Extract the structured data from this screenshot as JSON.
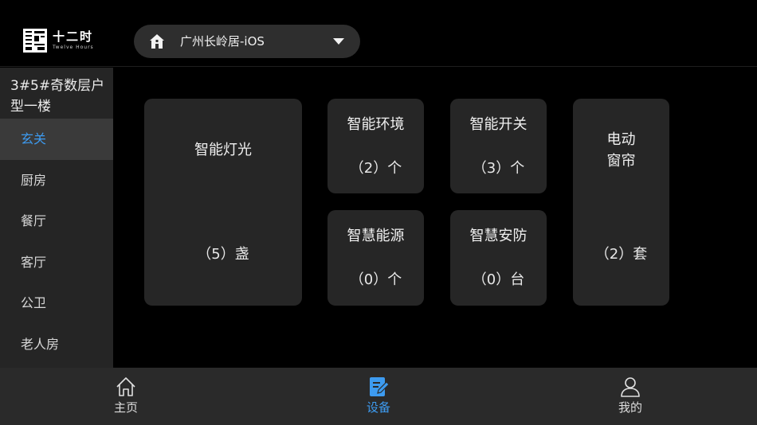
{
  "header": {
    "logo_cn": "十二时",
    "logo_en": "Twelve Hours",
    "location_label": "广州长岭居-iOS"
  },
  "sidebar": {
    "title": "3#5#奇数层户型一楼",
    "items": [
      {
        "label": "玄关",
        "active": true
      },
      {
        "label": "厨房",
        "active": false
      },
      {
        "label": "餐厅",
        "active": false
      },
      {
        "label": "客厅",
        "active": false
      },
      {
        "label": "公卫",
        "active": false
      },
      {
        "label": "老人房",
        "active": false
      }
    ]
  },
  "cards": {
    "lighting": {
      "name": "智能灯光",
      "count": "（5）盏"
    },
    "environment": {
      "name": "智能环境",
      "count": "（2）个"
    },
    "switch": {
      "name": "智能开关",
      "count": "（3）个"
    },
    "curtain": {
      "name_line1": "电动",
      "name_line2": "窗帘",
      "count": "（2）套"
    },
    "energy": {
      "name": "智慧能源",
      "count": "（0）个"
    },
    "security": {
      "name": "智慧安防",
      "count": "（0）台"
    }
  },
  "tabbar": {
    "home": "主页",
    "devices": "设备",
    "mine": "我的",
    "active": "devices"
  },
  "colors": {
    "accent": "#3d9bf0",
    "card_bg": "#262626",
    "sidebar_bg": "#252525",
    "tabbar_bg": "#2a2a2a"
  }
}
